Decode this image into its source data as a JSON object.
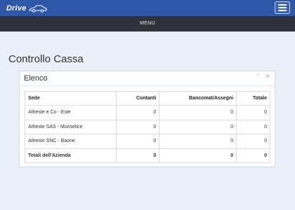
{
  "header": {
    "logo_text": "Drive",
    "menu_label": "MENU"
  },
  "colors": {
    "topbar": "#2e57a8",
    "menubar": "#2f3339",
    "background": "#e9eef7"
  },
  "page": {
    "title": "Controllo Cassa"
  },
  "panel": {
    "title": "Elenco",
    "collapse_icon": "chevron-up-icon",
    "close_icon": "close-icon"
  },
  "table": {
    "columns": [
      "Sede",
      "Contanti",
      "Bancomat/Assegni",
      "Totale"
    ],
    "rows": [
      [
        "Atheste e Co - Este",
        "0",
        "0",
        "0"
      ],
      [
        "Atheste SAS - Monselice",
        "0",
        "0",
        "0"
      ],
      [
        "Atheste SNC - Baone",
        "0",
        "0",
        "0"
      ]
    ],
    "totals": [
      "Totali dell'Azienda",
      "0",
      "0",
      "0"
    ]
  }
}
